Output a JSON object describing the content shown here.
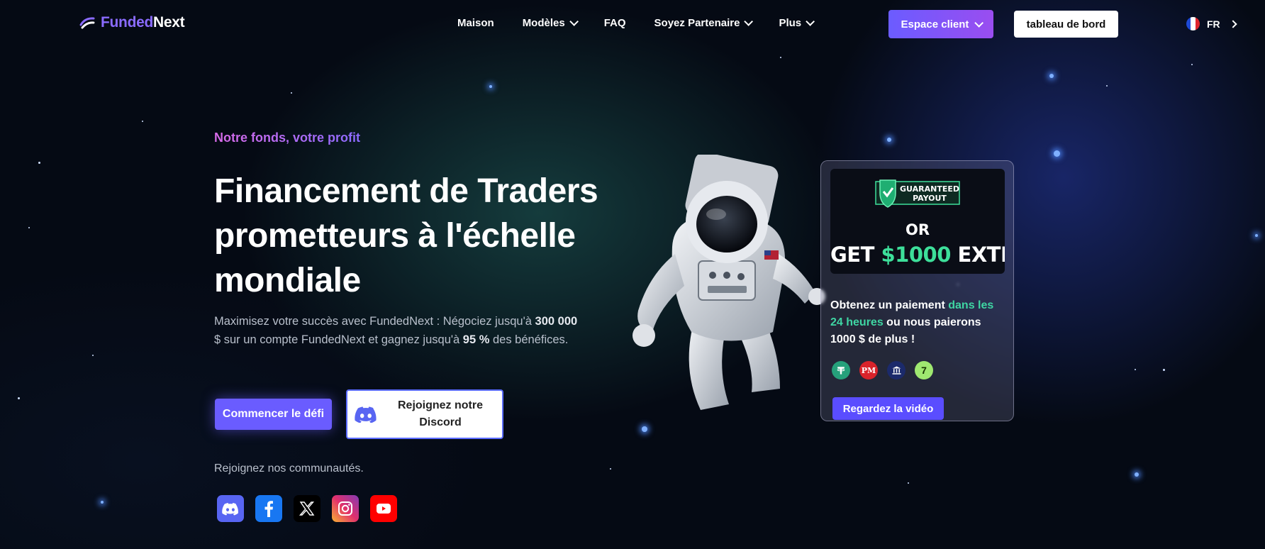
{
  "brand": {
    "name_part1": "Funded",
    "name_part2": "Next"
  },
  "nav": {
    "items": [
      {
        "label": "Maison",
        "dropdown": false
      },
      {
        "label": "Modèles",
        "dropdown": true
      },
      {
        "label": "FAQ",
        "dropdown": false
      },
      {
        "label": "Soyez Partenaire",
        "dropdown": true
      },
      {
        "label": "Plus",
        "dropdown": true
      }
    ],
    "client_button": "Espace client",
    "dashboard_button": "tableau de bord",
    "language": "FR"
  },
  "hero": {
    "tagline": "Notre fonds, votre profit",
    "headline": "Financement de Traders prometteurs à l'échelle mondiale",
    "desc_part1": "Maximisez votre succès avec FundedNext : Négociez jusqu'à ",
    "desc_bold1": "300 000",
    "desc_part2": " $ sur un compte FundedNext et gagnez jusqu'à ",
    "desc_bold2": "95 %",
    "desc_part3": " des bénéfices.",
    "start_button": "Commencer le défi",
    "discord_button": "Rejoignez notre Discord",
    "communities_label": "Rejoignez nos communautés."
  },
  "socials": [
    "discord-icon",
    "facebook-icon",
    "x-icon",
    "instagram-icon",
    "youtube-icon"
  ],
  "promo_card": {
    "badge_line1": "GUARANTEED",
    "badge_line2": "PAYOUT",
    "or_text": "OR",
    "extra_prefix": "GET ",
    "extra_money": "$1000",
    "extra_suffix": " EXTRA!",
    "text_part1": "Obtenez un paiement ",
    "text_highlight": "dans les 24 heures",
    "text_part2": " ou nous paierons 1000 $ de plus !",
    "payment_icons": [
      "tether-icon",
      "perfect-money-icon",
      "bank-icon",
      "wise-icon"
    ],
    "pm_label": "PM",
    "wise_label": "7",
    "video_button": "Regardez la vidéo"
  },
  "colors": {
    "accent": "#6a5cff",
    "highlight": "#3fd6a3",
    "gradient_start": "#6b5cff",
    "gradient_end": "#9a4df0"
  }
}
